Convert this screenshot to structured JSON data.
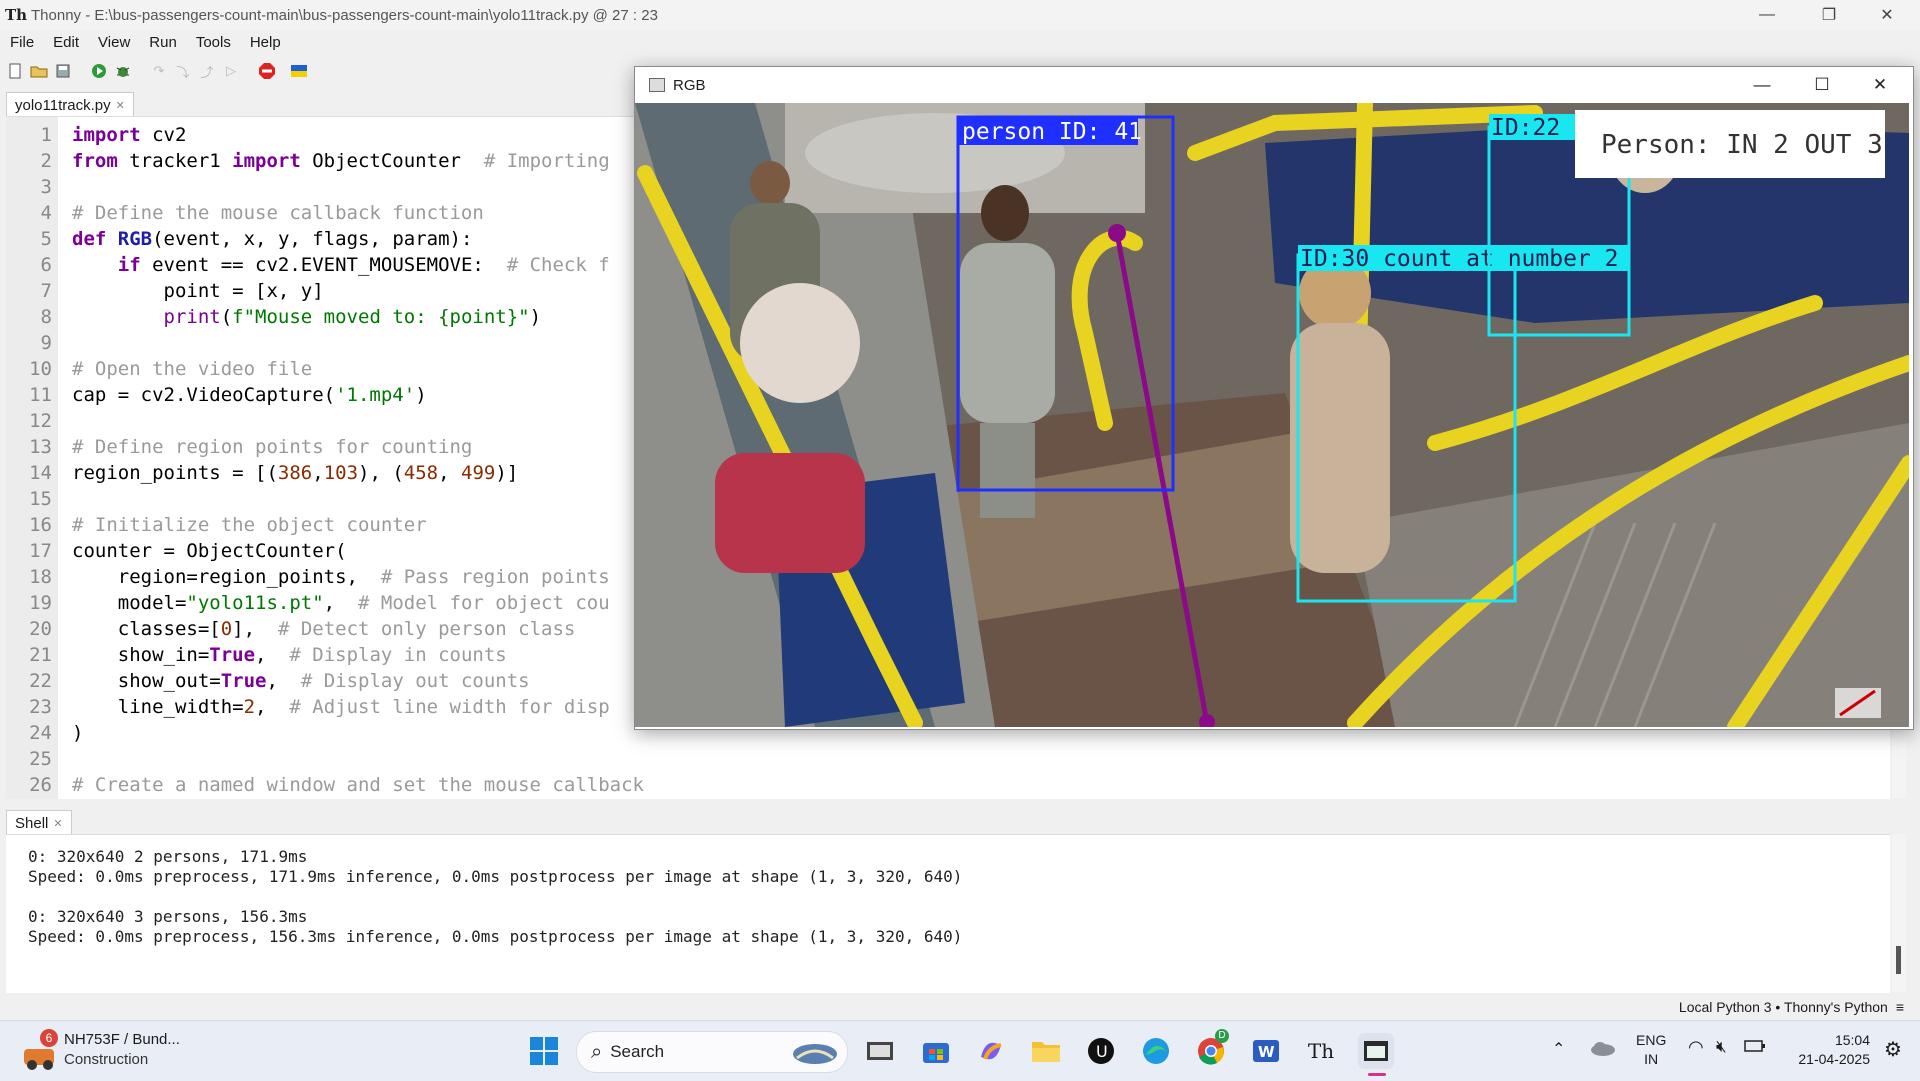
{
  "window": {
    "title": "Thonny  -  E:\\bus-passengers-count-main\\bus-passengers-count-main\\yolo11track.py  @  27 : 23",
    "app_icon": "Th"
  },
  "menu": [
    "File",
    "Edit",
    "View",
    "Run",
    "Tools",
    "Help"
  ],
  "editor": {
    "tab_label": "yolo11track.py",
    "lines": [
      {
        "n": "1"
      },
      {
        "n": "2"
      },
      {
        "n": "3"
      },
      {
        "n": "4"
      },
      {
        "n": "5"
      },
      {
        "n": "6"
      },
      {
        "n": "7"
      },
      {
        "n": "8"
      },
      {
        "n": "9"
      },
      {
        "n": "10"
      },
      {
        "n": "11"
      },
      {
        "n": "12"
      },
      {
        "n": "13"
      },
      {
        "n": "14"
      },
      {
        "n": "15"
      },
      {
        "n": "16"
      },
      {
        "n": "17"
      },
      {
        "n": "18"
      },
      {
        "n": "19"
      },
      {
        "n": "20"
      },
      {
        "n": "21"
      },
      {
        "n": "22"
      },
      {
        "n": "23"
      },
      {
        "n": "24"
      },
      {
        "n": "25"
      },
      {
        "n": "26"
      }
    ],
    "code": {
      "l1_kw": "import",
      "l1_rest": " cv2",
      "l2_kw1": "from",
      "l2_mid": " tracker1 ",
      "l2_kw2": "import",
      "l2_rest": " ObjectCounter  ",
      "l2_cm": "# Importing",
      "l4_cm": "# Define the mouse callback function",
      "l5_kw": "def",
      "l5_fn": "RGB",
      "l5_rest": "(event, x, y, flags, param):",
      "l6_kw": "if",
      "l6_rest": " event == cv2.EVENT_MOUSEMOVE:  ",
      "l6_cm": "# Check f",
      "l7": "point = [x, y]",
      "l8_bi": "print",
      "l8_a": "(",
      "l8_st": "f\"Mouse moved to: {point}\"",
      "l8_b": ")",
      "l10_cm": "# Open the video file",
      "l11_a": "cap = cv2.VideoCapture(",
      "l11_st": "'1.mp4'",
      "l11_b": ")",
      "l13_cm": "# Define region points for counting",
      "l14_a": "region_points = [(",
      "l14_n1": "386",
      "l14_b": ",",
      "l14_n2": "103",
      "l14_c": "), (",
      "l14_n3": "458",
      "l14_d": ", ",
      "l14_n4": "499",
      "l14_e": ")]",
      "l16_cm": "# Initialize the object counter",
      "l17": "counter = ObjectCounter(",
      "l18_a": "    region=region_points,  ",
      "l18_cm": "# Pass region points",
      "l19_a": "    model=",
      "l19_st": "\"yolo11s.pt\"",
      "l19_b": ",  ",
      "l19_cm": "# Model for object cou",
      "l20_a": "    classes=[",
      "l20_n": "0",
      "l20_b": "],  ",
      "l20_cm": "# Detect only person class",
      "l21_a": "    show_in=",
      "l21_t": "True",
      "l21_b": ",  ",
      "l21_cm": "# Display in counts",
      "l22_a": "    show_out=",
      "l22_t": "True",
      "l22_b": ",  ",
      "l22_cm": "# Display out counts",
      "l23_a": "    line_width=",
      "l23_n": "2",
      "l23_b": ",  ",
      "l23_cm": "# Adjust line width for disp",
      "l24": ")",
      "l26_cm": "# Create a named window and set the mouse callback"
    }
  },
  "shell": {
    "tab_label": "Shell",
    "lines": [
      "0: 320x640 2 persons, 171.9ms",
      "Speed: 0.0ms preprocess, 171.9ms inference, 0.0ms postprocess per image at shape (1, 3, 320, 640)",
      "",
      "0: 320x640 3 persons, 156.3ms",
      "Speed: 0.0ms preprocess, 156.3ms inference, 0.0ms postprocess per image at shape (1, 3, 320, 640)"
    ]
  },
  "status": {
    "interpreter": "Local Python 3  •  Thonny's Python",
    "menu_glyph": "≡"
  },
  "rgb_window": {
    "title": "RGB",
    "overlay": {
      "box1_label": "person ID: 41",
      "box2_label": "ID:22 count at number 2",
      "box3_label": "ID:30 count at number 2",
      "counter_text": "Person: IN 2 OUT 3"
    }
  },
  "taskbar": {
    "weather_badge": "6",
    "weather_title": "NH753F / Bund...",
    "weather_sub": "Construction",
    "search_placeholder": "Search",
    "lang1": "ENG",
    "lang2": "IN",
    "time": "15:04",
    "date": "21-04-2025",
    "chrome_badge": "D"
  }
}
